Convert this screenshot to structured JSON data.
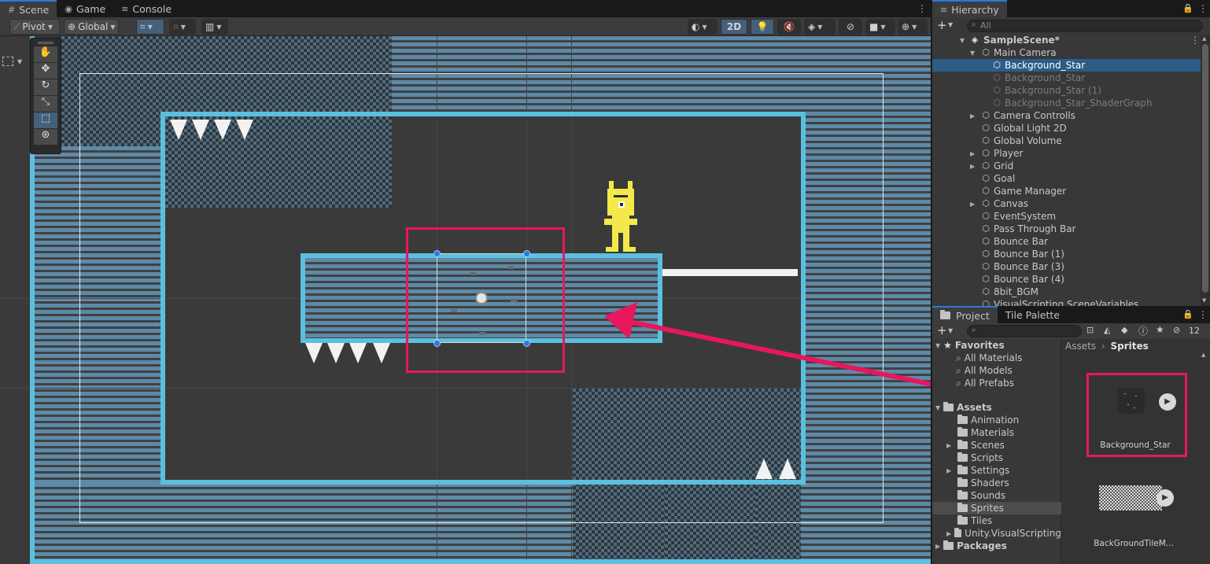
{
  "scene_tabs": [
    {
      "icon": "grid-icon",
      "label": "Scene"
    },
    {
      "icon": "gamepad-icon",
      "label": "Game"
    },
    {
      "icon": "list-icon",
      "label": "Console"
    }
  ],
  "scene_toolbar": {
    "pivot": "Pivot",
    "global": "Global",
    "two_d": "2D"
  },
  "tools": [
    "hand-tool",
    "move-tool",
    "rotate-tool",
    "scale-tool",
    "rect-tool",
    "transform-tool"
  ],
  "hierarchy": {
    "title": "Hierarchy",
    "search_placeholder": "All",
    "scene": "SampleScene*",
    "items": [
      {
        "label": "Main Camera",
        "depth": 1,
        "expanded": true
      },
      {
        "label": "Background_Star",
        "depth": 2,
        "selected": true
      },
      {
        "label": "Background_Star",
        "depth": 2,
        "dim": true
      },
      {
        "label": "Background_Star (1)",
        "depth": 2,
        "dim": true
      },
      {
        "label": "Background_Star_ShaderGraph",
        "depth": 2,
        "dim": true
      },
      {
        "label": "Camera Controlls",
        "depth": 1,
        "collapsed": true
      },
      {
        "label": "Global Light 2D",
        "depth": 1
      },
      {
        "label": "Global Volume",
        "depth": 1
      },
      {
        "label": "Player",
        "depth": 1,
        "collapsed": true
      },
      {
        "label": "Grid",
        "depth": 1,
        "collapsed": true
      },
      {
        "label": "Goal",
        "depth": 1
      },
      {
        "label": "Game Manager",
        "depth": 1
      },
      {
        "label": "Canvas",
        "depth": 1,
        "collapsed": true
      },
      {
        "label": "EventSystem",
        "depth": 1
      },
      {
        "label": "Pass Through Bar",
        "depth": 1
      },
      {
        "label": "Bounce Bar",
        "depth": 1
      },
      {
        "label": "Bounce Bar (1)",
        "depth": 1
      },
      {
        "label": "Bounce Bar (3)",
        "depth": 1
      },
      {
        "label": "Bounce Bar (4)",
        "depth": 1
      },
      {
        "label": "8bit_BGM",
        "depth": 1
      },
      {
        "label": "VisualScripting SceneVariables",
        "depth": 1
      }
    ]
  },
  "project": {
    "tabs": [
      "Project",
      "Tile Palette"
    ],
    "hidden_count": "12",
    "favorites_label": "Favorites",
    "favorites": [
      "All Materials",
      "All Models",
      "All Prefabs"
    ],
    "assets_label": "Assets",
    "folders": [
      {
        "label": "Animation"
      },
      {
        "label": "Materials"
      },
      {
        "label": "Scenes",
        "collapsed": true
      },
      {
        "label": "Scripts"
      },
      {
        "label": "Settings",
        "collapsed": true
      },
      {
        "label": "Shaders"
      },
      {
        "label": "Sounds"
      },
      {
        "label": "Sprites",
        "selected": true
      },
      {
        "label": "Tiles"
      },
      {
        "label": "Unity.VisualScripting",
        "collapsed": true
      }
    ],
    "packages_label": "Packages",
    "breadcrumb": [
      "Assets",
      "Sprites"
    ],
    "asset_items": [
      "Background_Star",
      "BackGroundTileM..."
    ]
  },
  "colors": {
    "highlight": "#e8175d",
    "accent": "#5bc0de",
    "selection": "#2c5d87"
  }
}
